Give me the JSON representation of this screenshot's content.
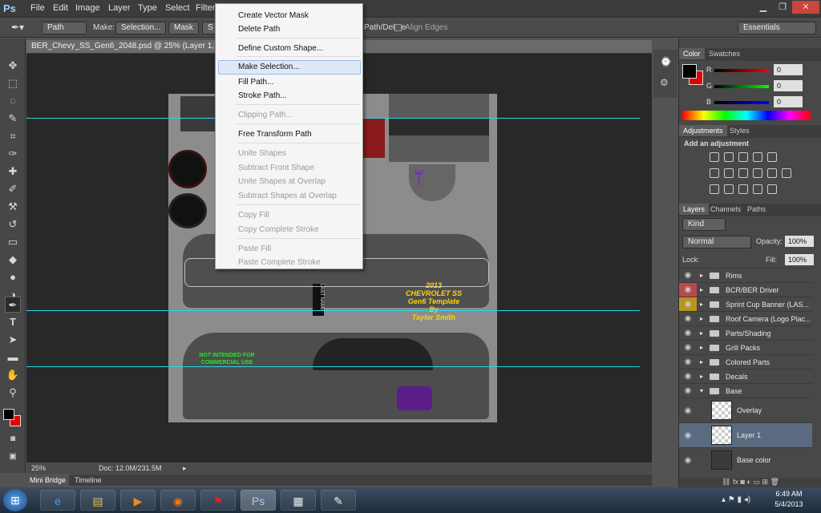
{
  "menubar": {
    "logo": "Ps",
    "items": [
      "File",
      "Edit",
      "Image",
      "Layer",
      "Type",
      "Select",
      "Filter"
    ],
    "win_min": "▁",
    "win_max": "❐",
    "win_close": "✕"
  },
  "options": {
    "mode": "Path",
    "make_label": "Make:",
    "selection_btn": "Selection...",
    "mask_btn": "Mask",
    "shape_btn": "S",
    "path_delete": "Path/Delete",
    "align_edges": "Align Edges",
    "workspace": "Essentials"
  },
  "document": {
    "tab_title": "BER_Chevy_SS_Gen6_2048.psd @ 25% (Layer 1, RGB/8#)",
    "zoom": "25%",
    "doc_size": "Doc: 12.0M/231.5M"
  },
  "bottom_tabs": [
    "Mini Bridge",
    "Timeline"
  ],
  "template_text": {
    "year": "2013",
    "model": "CHEVROLET SS",
    "subtitle": "Gen6 Template By",
    "author": "Taylor Smith",
    "warning": "NOT INTENDED FOR COMMERCIAL USE",
    "last_name": "LAST NAME"
  },
  "context_menu": {
    "items": [
      {
        "label": "Create Vector Mask",
        "enabled": true
      },
      {
        "label": "Delete Path",
        "enabled": true
      },
      {
        "label": "Define Custom Shape...",
        "enabled": true
      },
      {
        "label": "Make Selection...",
        "enabled": true
      },
      {
        "label": "Fill Path...",
        "enabled": true
      },
      {
        "label": "Stroke Path...",
        "enabled": true
      },
      {
        "label": "Clipping Path...",
        "enabled": false
      },
      {
        "label": "Free Transform Path",
        "enabled": true
      },
      {
        "label": "Unite Shapes",
        "enabled": false
      },
      {
        "label": "Subtract Front Shape",
        "enabled": false
      },
      {
        "label": "Unite Shapes at Overlap",
        "enabled": false
      },
      {
        "label": "Subtract Shapes at Overlap",
        "enabled": false
      },
      {
        "label": "Copy Fill",
        "enabled": false
      },
      {
        "label": "Copy Complete Stroke",
        "enabled": false
      },
      {
        "label": "Paste Fill",
        "enabled": false
      },
      {
        "label": "Paste Complete Stroke",
        "enabled": false
      }
    ]
  },
  "color_panel": {
    "tabs": [
      "Color",
      "Swatches"
    ],
    "r_label": "R",
    "g_label": "G",
    "b_label": "B",
    "r": "0",
    "g": "0",
    "b": "0"
  },
  "adjust_panel": {
    "tabs": [
      "Adjustments",
      "Styles"
    ],
    "heading": "Add an adjustment"
  },
  "layers_panel": {
    "tabs": [
      "Layers",
      "Channels",
      "Paths"
    ],
    "kind": "Kind",
    "blend": "Normal",
    "opacity_label": "Opacity:",
    "opacity": "100%",
    "lock_label": "Lock:",
    "fill_label": "Fill:",
    "fill": "100%",
    "layers": [
      {
        "name": "Rims",
        "type": "group"
      },
      {
        "name": "BCR/BER Driver",
        "type": "group",
        "eye_color": "#b94a4a"
      },
      {
        "name": "Sprint Cup Banner (LAS...",
        "type": "group",
        "eye_color": "#b9951f"
      },
      {
        "name": "Roof Camera (Logo Plac...",
        "type": "group"
      },
      {
        "name": "Parts/Shading",
        "type": "group"
      },
      {
        "name": "Grill Packs",
        "type": "group"
      },
      {
        "name": "Colored Parts",
        "type": "group"
      },
      {
        "name": "Decals",
        "type": "group"
      },
      {
        "name": "Base",
        "type": "group-open"
      },
      {
        "name": "Overlay",
        "type": "layer"
      },
      {
        "name": "Layer 1",
        "type": "layer",
        "selected": true
      },
      {
        "name": "Base color",
        "type": "layer"
      }
    ]
  },
  "taskbar": {
    "time": "6:49 AM",
    "date": "5/4/2013"
  }
}
